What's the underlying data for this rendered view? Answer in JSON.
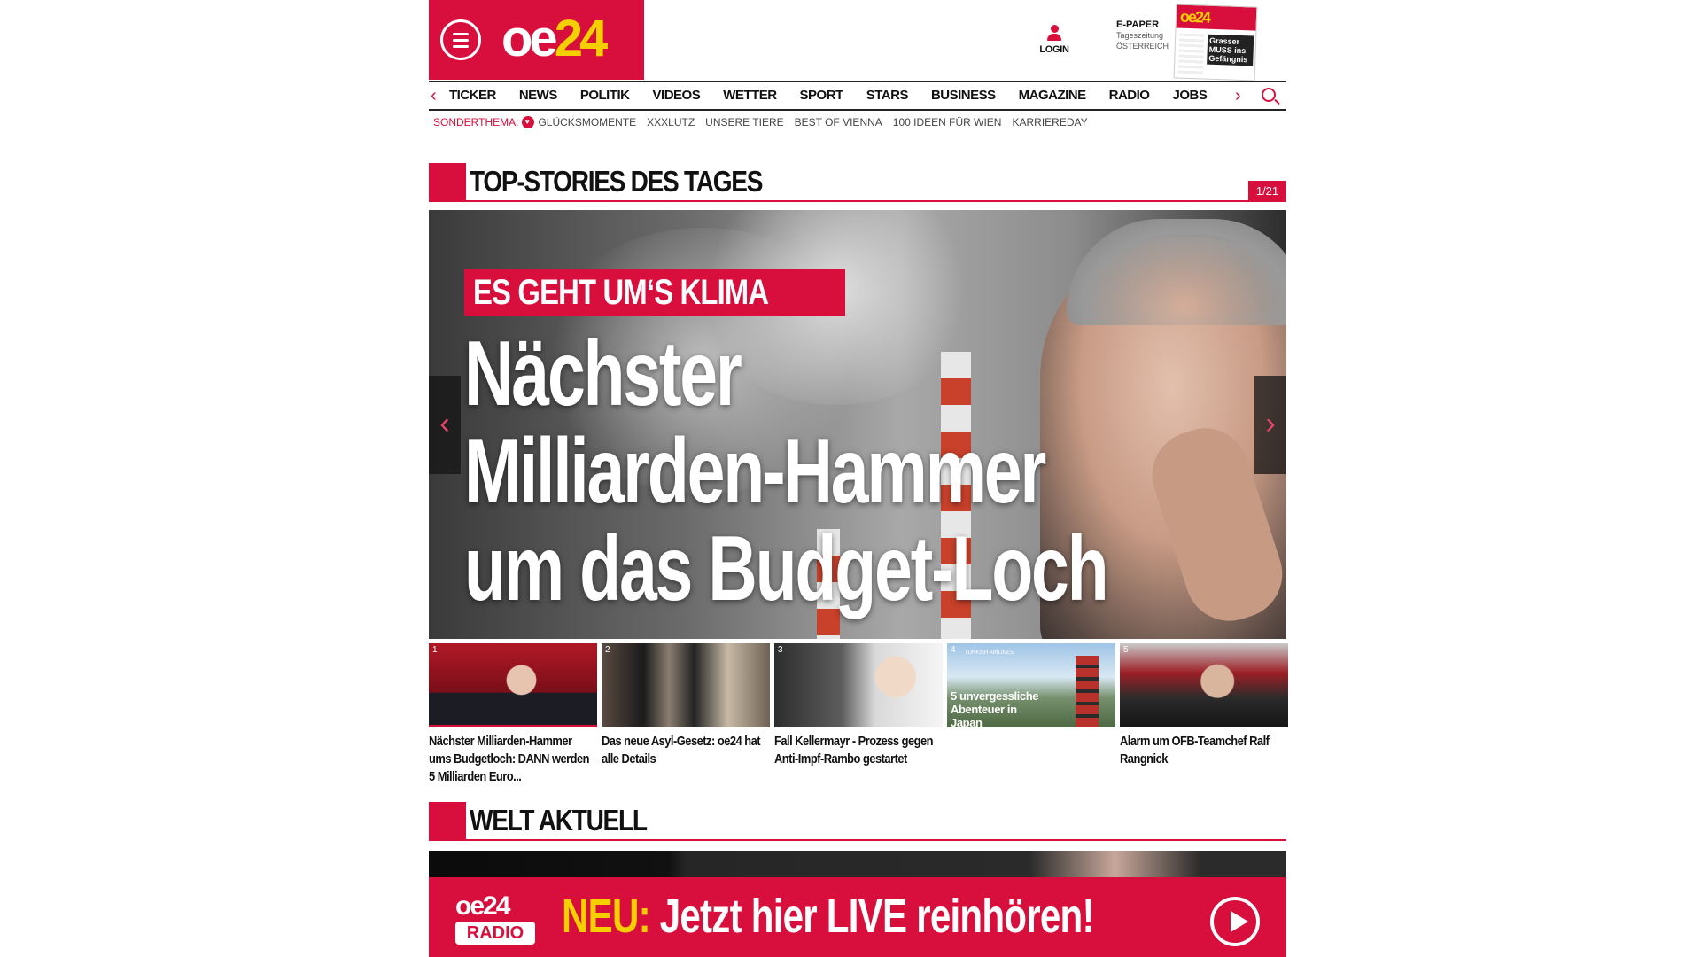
{
  "header": {
    "logo_text": "oe24",
    "login_label": "LOGIN",
    "epaper": {
      "title": "E-PAPER",
      "line2": "Tageszeitung",
      "line3": "ÖSTERREICH",
      "cover_headline": "Grasser MUSS ins Gefängnis"
    }
  },
  "nav": {
    "items": [
      "TICKER",
      "NEWS",
      "POLITIK",
      "VIDEOS",
      "WETTER",
      "SPORT",
      "STARS",
      "BUSINESS",
      "MAGAZINE",
      "RADIO",
      "JOBS"
    ]
  },
  "subnav": {
    "label": "SONDERTHEMA:",
    "items": [
      "GLÜCKSMOMENTE",
      "XXXLUTZ",
      "UNSERE TIERE",
      "BEST OF VIENNA",
      "100 IDEEN FÜR WIEN",
      "KARRIEREDAY"
    ]
  },
  "top_stories": {
    "title": "TOP-STORIES DES TAGES",
    "counter": "1/21",
    "hero": {
      "kicker": "ES GEHT UM‘S KLIMA",
      "headline_lines": [
        "Nächster",
        "Milliarden-Hammer",
        "um das Budget-Loch"
      ]
    },
    "teasers": [
      {
        "num": "1",
        "caption": "Nächster Milliarden-Hammer ums Budgetloch: DANN werden 5 Milliarden Euro...",
        "active": true
      },
      {
        "num": "2",
        "caption": "Das neue Asyl-Gesetz: oe24 hat alle Details"
      },
      {
        "num": "3",
        "caption": "Fall Kellermayr - Prozess gegen Anti-Impf-Rambo gestartet"
      },
      {
        "num": "4",
        "caption": "",
        "overlay": "5 unvergessliche Abenteuer in Japan",
        "brand": "TURKISH AIRLINES"
      },
      {
        "num": "5",
        "caption": "Alarm um OFB-Teamchef Ralf Rangnick"
      }
    ]
  },
  "welt": {
    "title": "WELT AKTUELL"
  },
  "radio_banner": {
    "logo_top": "oe24",
    "logo_bottom": "RADIO",
    "neu": "NEU:",
    "text": "Jetzt hier LIVE reinhören!"
  },
  "colors": {
    "brand_red": "#d80f3c",
    "brand_yellow": "#f4d000"
  }
}
